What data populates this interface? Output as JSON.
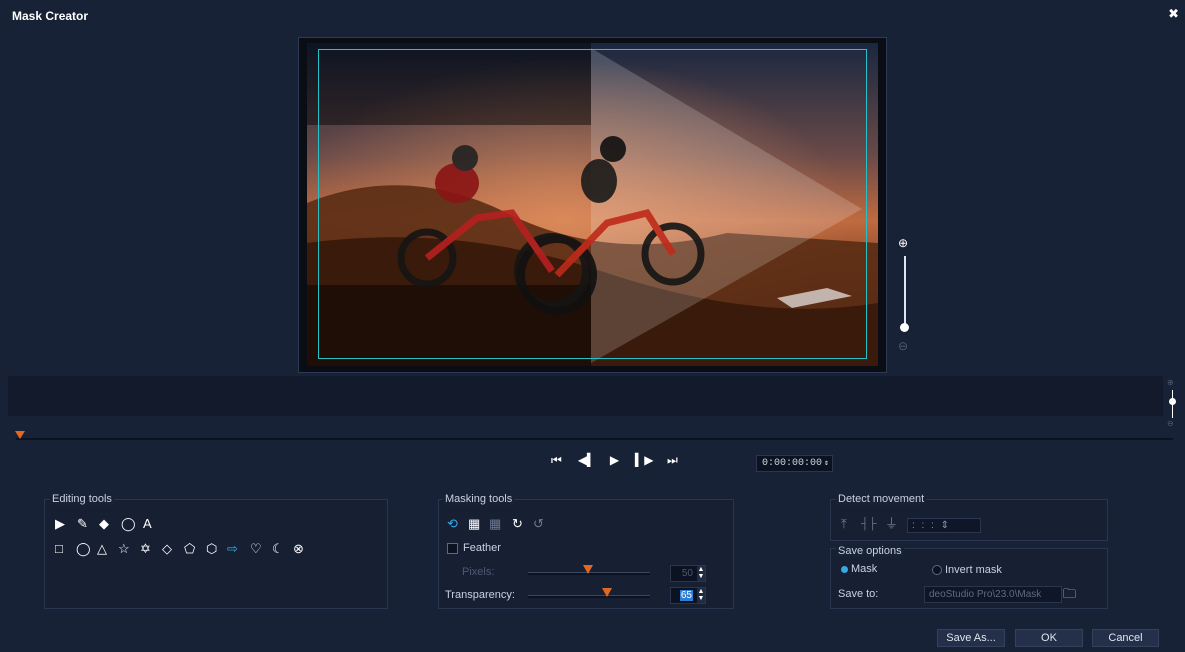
{
  "window": {
    "title": "Mask Creator",
    "close_icon": "close-icon"
  },
  "transport": {
    "buttons": [
      "go-to-start-icon",
      "prev-frame-icon",
      "play-icon",
      "next-frame-icon",
      "go-to-end-icon"
    ],
    "glyphs": [
      "⏮",
      "◀▍",
      "▶",
      "▍▶",
      "⏭"
    ],
    "timecode": "0:00:00:00",
    "spin": "⇕"
  },
  "editing_tools": {
    "label": "Editing tools",
    "row1": [
      "▶",
      "✎",
      "◆",
      "◯",
      "A"
    ],
    "row2": [
      "□",
      "◯",
      "△",
      "☆",
      "✡",
      "◇",
      "⬠",
      "⬡",
      "⇨",
      "♡",
      "☾",
      "⊗"
    ]
  },
  "masking_tools": {
    "label": "Masking tools",
    "icons": [
      "⟲",
      "▦",
      "▦",
      "↻",
      "↺"
    ],
    "feather_label": "Feather",
    "pixels_label": "Pixels:",
    "pixels_value": "50",
    "pixels_level": 0.49,
    "transparency_label": "Transparency:",
    "transparency_value": "65",
    "transparency_level": 0.65
  },
  "detect_movement": {
    "label": "Detect movement",
    "icons": [
      "⤒",
      "┤├",
      "⏚"
    ],
    "timecode": ": : : ⇕"
  },
  "save_options": {
    "label": "Save options",
    "mask_label": "Mask",
    "invert_label": "Invert mask",
    "save_to_label": "Save to:",
    "path": "deoStudio Pro\\23.0\\Mask",
    "folder_icon": "🗀"
  },
  "buttons": {
    "save_as": "Save As...",
    "ok": "OK",
    "cancel": "Cancel"
  },
  "colors": {
    "accent": "#23c2c9",
    "knob": "#e06820",
    "active": "#3aa7e8"
  }
}
